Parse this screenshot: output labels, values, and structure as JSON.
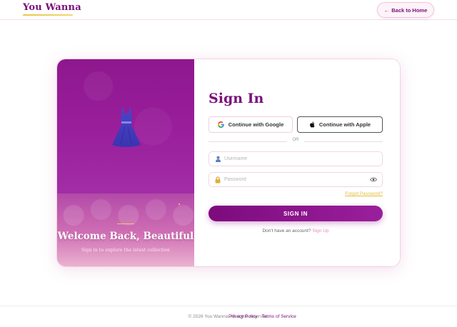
{
  "header": {
    "brand": "You Wanna",
    "back_label": "Back to Home",
    "back_arrow": "←"
  },
  "hero": {
    "title": "Welcome Back, Beautiful",
    "subtitle": "Sign in to explore the latest collection",
    "image_icon": "dress-icon"
  },
  "form": {
    "title": "Sign In",
    "google_label": "Continue with Google",
    "apple_label": "Continue with Apple",
    "divider": "OR",
    "username_placeholder": "Username",
    "password_placeholder": "Password",
    "forgot_label": "Forgot Password?",
    "submit_label": "SIGN IN",
    "signup_prompt": "Don't have an account?",
    "signup_link": "Sign Up"
  },
  "footer": {
    "copyright": "© 2026 You Wanna. All rights reserved.",
    "links": [
      "Privacy Policy",
      "Terms of Service"
    ]
  },
  "colors": {
    "primary": "#7a0f7a",
    "accent_gold": "#e0be3c",
    "pink_link": "#e78bb8"
  }
}
